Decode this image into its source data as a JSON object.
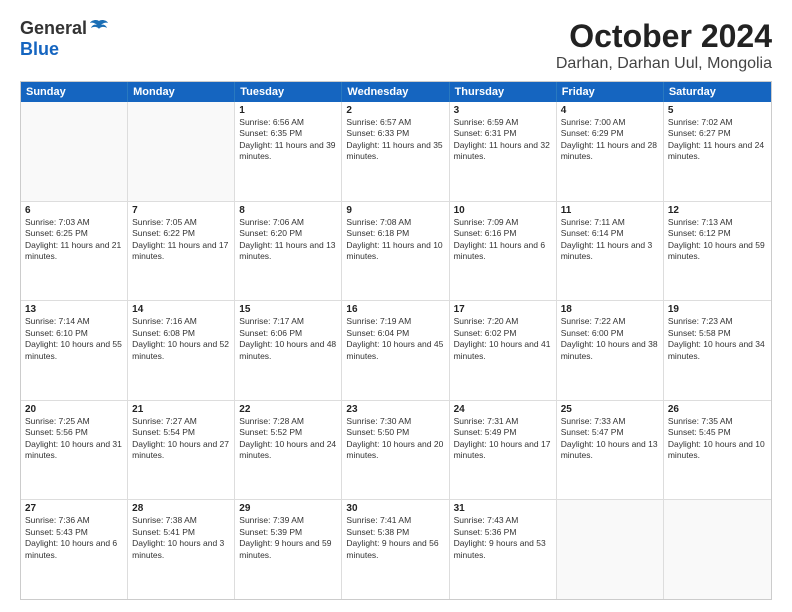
{
  "logo": {
    "general": "General",
    "blue": "Blue"
  },
  "title": "October 2024",
  "subtitle": "Darhan, Darhan Uul, Mongolia",
  "days": [
    "Sunday",
    "Monday",
    "Tuesday",
    "Wednesday",
    "Thursday",
    "Friday",
    "Saturday"
  ],
  "rows": [
    [
      {
        "day": "",
        "content": "",
        "empty": true
      },
      {
        "day": "",
        "content": "",
        "empty": true
      },
      {
        "day": "1",
        "content": "Sunrise: 6:56 AM\nSunset: 6:35 PM\nDaylight: 11 hours and 39 minutes."
      },
      {
        "day": "2",
        "content": "Sunrise: 6:57 AM\nSunset: 6:33 PM\nDaylight: 11 hours and 35 minutes."
      },
      {
        "day": "3",
        "content": "Sunrise: 6:59 AM\nSunset: 6:31 PM\nDaylight: 11 hours and 32 minutes."
      },
      {
        "day": "4",
        "content": "Sunrise: 7:00 AM\nSunset: 6:29 PM\nDaylight: 11 hours and 28 minutes."
      },
      {
        "day": "5",
        "content": "Sunrise: 7:02 AM\nSunset: 6:27 PM\nDaylight: 11 hours and 24 minutes."
      }
    ],
    [
      {
        "day": "6",
        "content": "Sunrise: 7:03 AM\nSunset: 6:25 PM\nDaylight: 11 hours and 21 minutes."
      },
      {
        "day": "7",
        "content": "Sunrise: 7:05 AM\nSunset: 6:22 PM\nDaylight: 11 hours and 17 minutes."
      },
      {
        "day": "8",
        "content": "Sunrise: 7:06 AM\nSunset: 6:20 PM\nDaylight: 11 hours and 13 minutes."
      },
      {
        "day": "9",
        "content": "Sunrise: 7:08 AM\nSunset: 6:18 PM\nDaylight: 11 hours and 10 minutes."
      },
      {
        "day": "10",
        "content": "Sunrise: 7:09 AM\nSunset: 6:16 PM\nDaylight: 11 hours and 6 minutes."
      },
      {
        "day": "11",
        "content": "Sunrise: 7:11 AM\nSunset: 6:14 PM\nDaylight: 11 hours and 3 minutes."
      },
      {
        "day": "12",
        "content": "Sunrise: 7:13 AM\nSunset: 6:12 PM\nDaylight: 10 hours and 59 minutes."
      }
    ],
    [
      {
        "day": "13",
        "content": "Sunrise: 7:14 AM\nSunset: 6:10 PM\nDaylight: 10 hours and 55 minutes."
      },
      {
        "day": "14",
        "content": "Sunrise: 7:16 AM\nSunset: 6:08 PM\nDaylight: 10 hours and 52 minutes."
      },
      {
        "day": "15",
        "content": "Sunrise: 7:17 AM\nSunset: 6:06 PM\nDaylight: 10 hours and 48 minutes."
      },
      {
        "day": "16",
        "content": "Sunrise: 7:19 AM\nSunset: 6:04 PM\nDaylight: 10 hours and 45 minutes."
      },
      {
        "day": "17",
        "content": "Sunrise: 7:20 AM\nSunset: 6:02 PM\nDaylight: 10 hours and 41 minutes."
      },
      {
        "day": "18",
        "content": "Sunrise: 7:22 AM\nSunset: 6:00 PM\nDaylight: 10 hours and 38 minutes."
      },
      {
        "day": "19",
        "content": "Sunrise: 7:23 AM\nSunset: 5:58 PM\nDaylight: 10 hours and 34 minutes."
      }
    ],
    [
      {
        "day": "20",
        "content": "Sunrise: 7:25 AM\nSunset: 5:56 PM\nDaylight: 10 hours and 31 minutes."
      },
      {
        "day": "21",
        "content": "Sunrise: 7:27 AM\nSunset: 5:54 PM\nDaylight: 10 hours and 27 minutes."
      },
      {
        "day": "22",
        "content": "Sunrise: 7:28 AM\nSunset: 5:52 PM\nDaylight: 10 hours and 24 minutes."
      },
      {
        "day": "23",
        "content": "Sunrise: 7:30 AM\nSunset: 5:50 PM\nDaylight: 10 hours and 20 minutes."
      },
      {
        "day": "24",
        "content": "Sunrise: 7:31 AM\nSunset: 5:49 PM\nDaylight: 10 hours and 17 minutes."
      },
      {
        "day": "25",
        "content": "Sunrise: 7:33 AM\nSunset: 5:47 PM\nDaylight: 10 hours and 13 minutes."
      },
      {
        "day": "26",
        "content": "Sunrise: 7:35 AM\nSunset: 5:45 PM\nDaylight: 10 hours and 10 minutes."
      }
    ],
    [
      {
        "day": "27",
        "content": "Sunrise: 7:36 AM\nSunset: 5:43 PM\nDaylight: 10 hours and 6 minutes."
      },
      {
        "day": "28",
        "content": "Sunrise: 7:38 AM\nSunset: 5:41 PM\nDaylight: 10 hours and 3 minutes."
      },
      {
        "day": "29",
        "content": "Sunrise: 7:39 AM\nSunset: 5:39 PM\nDaylight: 9 hours and 59 minutes."
      },
      {
        "day": "30",
        "content": "Sunrise: 7:41 AM\nSunset: 5:38 PM\nDaylight: 9 hours and 56 minutes."
      },
      {
        "day": "31",
        "content": "Sunrise: 7:43 AM\nSunset: 5:36 PM\nDaylight: 9 hours and 53 minutes."
      },
      {
        "day": "",
        "content": "",
        "empty": true
      },
      {
        "day": "",
        "content": "",
        "empty": true
      }
    ]
  ]
}
